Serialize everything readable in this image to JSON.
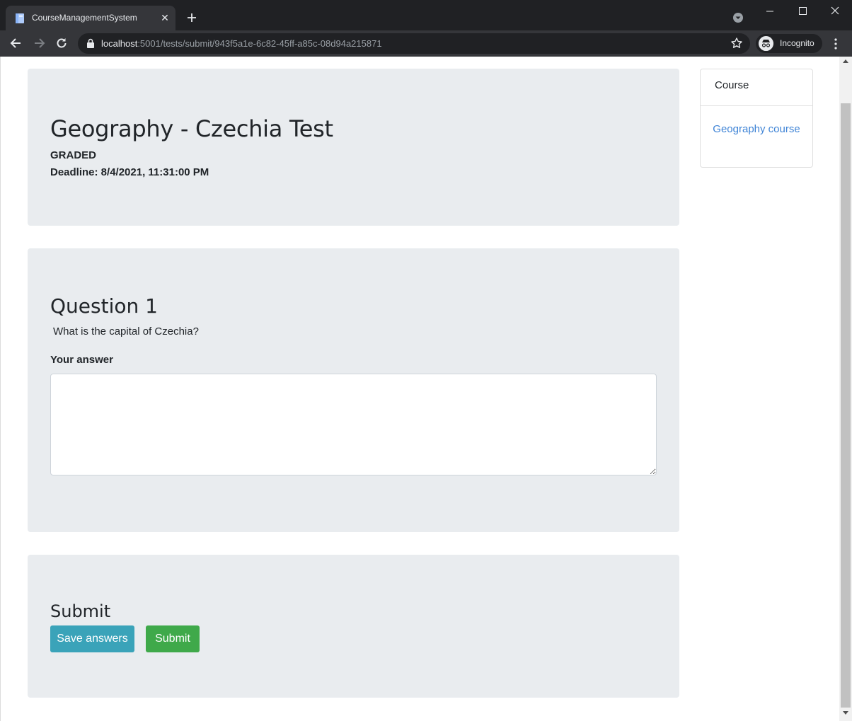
{
  "browser": {
    "tab_title": "CourseManagementSystem",
    "url_host": "localhost",
    "url_rest": ":5001/tests/submit/943f5a1e-6c82-45ff-a85c-08d94a215871",
    "profile_label": "Incognito"
  },
  "test": {
    "title": "Geography - Czechia Test",
    "status": "GRADED",
    "deadline": "Deadline: 8/4/2021, 11:31:00 PM"
  },
  "question": {
    "title": "Question 1",
    "text": "What is the capital of Czechia?",
    "answer_label": "Your answer",
    "answer_value": ""
  },
  "submit_section": {
    "title": "Submit",
    "save_label": "Save answers",
    "submit_label": "Submit"
  },
  "sidebar": {
    "header": "Course",
    "link": "Geography course"
  },
  "colors": {
    "card_bg": "#e9ecef",
    "link": "#3f84d6",
    "save_button": "#3aa3b9",
    "submit_button": "#3fa94a"
  }
}
